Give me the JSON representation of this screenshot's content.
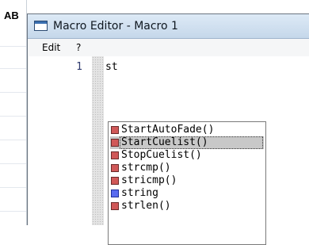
{
  "background_app": {
    "label": "AB"
  },
  "window": {
    "title": "Macro Editor - Macro 1",
    "menu": [
      "Edit",
      "?"
    ]
  },
  "editor": {
    "line_number": "1",
    "code": "st"
  },
  "autocomplete": {
    "selected_index": 1,
    "items": [
      {
        "label": "StartAutoFade()",
        "icon": "function-icon",
        "color": "#d05858"
      },
      {
        "label": "StartCuelist()",
        "icon": "function-icon",
        "color": "#d05858"
      },
      {
        "label": "StopCuelist()",
        "icon": "function-icon",
        "color": "#d05858"
      },
      {
        "label": "strcmp()",
        "icon": "function-icon",
        "color": "#d05858"
      },
      {
        "label": "stricmp()",
        "icon": "function-icon",
        "color": "#d05858"
      },
      {
        "label": "string",
        "icon": "type-icon",
        "color": "#5a6cf0"
      },
      {
        "label": "strlen()",
        "icon": "function-icon",
        "color": "#d05858"
      }
    ]
  }
}
